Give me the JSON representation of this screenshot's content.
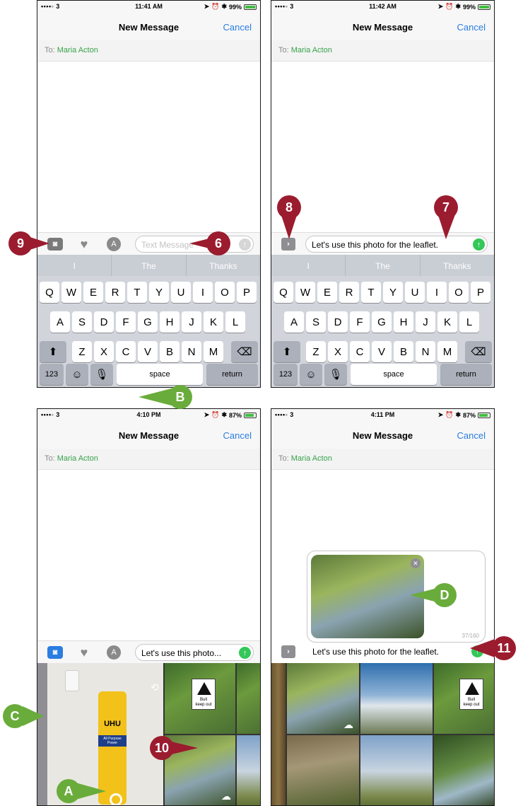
{
  "common": {
    "title": "New Message",
    "cancel": "Cancel",
    "to_label": "To:",
    "recipient": "Maria Acton",
    "carrier_signal": "••••◦ 3"
  },
  "screens": [
    {
      "time": "11:41 AM",
      "battery": "99%",
      "battery_level": 0.99
    },
    {
      "time": "11:42 AM",
      "battery": "99%",
      "battery_level": 0.99
    },
    {
      "time": "4:10 PM",
      "battery": "87%",
      "battery_level": 0.87
    },
    {
      "time": "4:11 PM",
      "battery": "87%",
      "battery_level": 0.87
    }
  ],
  "screen1": {
    "placeholder": "Text Message",
    "predictions": [
      "I",
      "The",
      "Thanks"
    ]
  },
  "screen2": {
    "message": "Let's use this photo for the leaflet.",
    "predictions": [
      "I",
      "The",
      "Thanks"
    ]
  },
  "screen3": {
    "message_truncated": "Let's use this photo..."
  },
  "screen4": {
    "message": "Let's use this photo for the leaflet.",
    "char_count": "37/160"
  },
  "keyboard": {
    "row1": [
      "Q",
      "W",
      "E",
      "R",
      "T",
      "Y",
      "U",
      "I",
      "O",
      "P"
    ],
    "row2": [
      "A",
      "S",
      "D",
      "F",
      "G",
      "H",
      "J",
      "K",
      "L"
    ],
    "row3": [
      "Z",
      "X",
      "C",
      "V",
      "B",
      "N",
      "M"
    ],
    "numbers": "123",
    "space": "space",
    "return": "return"
  },
  "photo_sign": {
    "line1": "Bull",
    "line2": "keep out"
  },
  "tube_label": {
    "brand": "UHU",
    "line1": "All Purpose",
    "line2": "Power"
  },
  "callouts": {
    "c6": "6",
    "c7": "7",
    "c8": "8",
    "c9": "9",
    "c10": "10",
    "c11": "11",
    "cA": "A",
    "cB": "B",
    "cC": "C",
    "cD": "D"
  },
  "colors": {
    "callout_red": "#9b1c2e",
    "callout_green": "#6aac3b",
    "link_blue": "#2a7de1",
    "recipient_green": "#37a34a"
  },
  "icons": [
    "camera-icon",
    "digital-touch-icon",
    "app-store-icon",
    "send-arrow-icon",
    "chevron-right-icon",
    "shift-icon",
    "delete-icon",
    "emoji-icon",
    "microphone-icon",
    "camera-switch-icon",
    "close-icon",
    "cloud-icon"
  ]
}
